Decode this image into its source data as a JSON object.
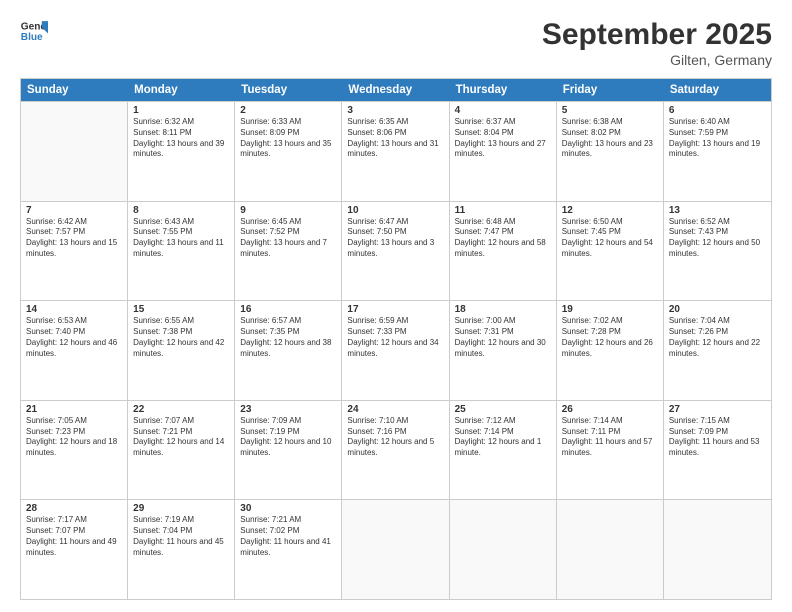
{
  "header": {
    "logo_line1": "General",
    "logo_line2": "Blue",
    "month": "September 2025",
    "location": "Gilten, Germany"
  },
  "days_of_week": [
    "Sunday",
    "Monday",
    "Tuesday",
    "Wednesday",
    "Thursday",
    "Friday",
    "Saturday"
  ],
  "weeks": [
    [
      {
        "day": "",
        "empty": true
      },
      {
        "day": "1",
        "sunrise": "6:32 AM",
        "sunset": "8:11 PM",
        "daylight": "13 hours and 39 minutes."
      },
      {
        "day": "2",
        "sunrise": "6:33 AM",
        "sunset": "8:09 PM",
        "daylight": "13 hours and 35 minutes."
      },
      {
        "day": "3",
        "sunrise": "6:35 AM",
        "sunset": "8:06 PM",
        "daylight": "13 hours and 31 minutes."
      },
      {
        "day": "4",
        "sunrise": "6:37 AM",
        "sunset": "8:04 PM",
        "daylight": "13 hours and 27 minutes."
      },
      {
        "day": "5",
        "sunrise": "6:38 AM",
        "sunset": "8:02 PM",
        "daylight": "13 hours and 23 minutes."
      },
      {
        "day": "6",
        "sunrise": "6:40 AM",
        "sunset": "7:59 PM",
        "daylight": "13 hours and 19 minutes."
      }
    ],
    [
      {
        "day": "7",
        "sunrise": "6:42 AM",
        "sunset": "7:57 PM",
        "daylight": "13 hours and 15 minutes."
      },
      {
        "day": "8",
        "sunrise": "6:43 AM",
        "sunset": "7:55 PM",
        "daylight": "13 hours and 11 minutes."
      },
      {
        "day": "9",
        "sunrise": "6:45 AM",
        "sunset": "7:52 PM",
        "daylight": "13 hours and 7 minutes."
      },
      {
        "day": "10",
        "sunrise": "6:47 AM",
        "sunset": "7:50 PM",
        "daylight": "13 hours and 3 minutes."
      },
      {
        "day": "11",
        "sunrise": "6:48 AM",
        "sunset": "7:47 PM",
        "daylight": "12 hours and 58 minutes."
      },
      {
        "day": "12",
        "sunrise": "6:50 AM",
        "sunset": "7:45 PM",
        "daylight": "12 hours and 54 minutes."
      },
      {
        "day": "13",
        "sunrise": "6:52 AM",
        "sunset": "7:43 PM",
        "daylight": "12 hours and 50 minutes."
      }
    ],
    [
      {
        "day": "14",
        "sunrise": "6:53 AM",
        "sunset": "7:40 PM",
        "daylight": "12 hours and 46 minutes."
      },
      {
        "day": "15",
        "sunrise": "6:55 AM",
        "sunset": "7:38 PM",
        "daylight": "12 hours and 42 minutes."
      },
      {
        "day": "16",
        "sunrise": "6:57 AM",
        "sunset": "7:35 PM",
        "daylight": "12 hours and 38 minutes."
      },
      {
        "day": "17",
        "sunrise": "6:59 AM",
        "sunset": "7:33 PM",
        "daylight": "12 hours and 34 minutes."
      },
      {
        "day": "18",
        "sunrise": "7:00 AM",
        "sunset": "7:31 PM",
        "daylight": "12 hours and 30 minutes."
      },
      {
        "day": "19",
        "sunrise": "7:02 AM",
        "sunset": "7:28 PM",
        "daylight": "12 hours and 26 minutes."
      },
      {
        "day": "20",
        "sunrise": "7:04 AM",
        "sunset": "7:26 PM",
        "daylight": "12 hours and 22 minutes."
      }
    ],
    [
      {
        "day": "21",
        "sunrise": "7:05 AM",
        "sunset": "7:23 PM",
        "daylight": "12 hours and 18 minutes."
      },
      {
        "day": "22",
        "sunrise": "7:07 AM",
        "sunset": "7:21 PM",
        "daylight": "12 hours and 14 minutes."
      },
      {
        "day": "23",
        "sunrise": "7:09 AM",
        "sunset": "7:19 PM",
        "daylight": "12 hours and 10 minutes."
      },
      {
        "day": "24",
        "sunrise": "7:10 AM",
        "sunset": "7:16 PM",
        "daylight": "12 hours and 5 minutes."
      },
      {
        "day": "25",
        "sunrise": "7:12 AM",
        "sunset": "7:14 PM",
        "daylight": "12 hours and 1 minute."
      },
      {
        "day": "26",
        "sunrise": "7:14 AM",
        "sunset": "7:11 PM",
        "daylight": "11 hours and 57 minutes."
      },
      {
        "day": "27",
        "sunrise": "7:15 AM",
        "sunset": "7:09 PM",
        "daylight": "11 hours and 53 minutes."
      }
    ],
    [
      {
        "day": "28",
        "sunrise": "7:17 AM",
        "sunset": "7:07 PM",
        "daylight": "11 hours and 49 minutes."
      },
      {
        "day": "29",
        "sunrise": "7:19 AM",
        "sunset": "7:04 PM",
        "daylight": "11 hours and 45 minutes."
      },
      {
        "day": "30",
        "sunrise": "7:21 AM",
        "sunset": "7:02 PM",
        "daylight": "11 hours and 41 minutes."
      },
      {
        "day": "",
        "empty": true
      },
      {
        "day": "",
        "empty": true
      },
      {
        "day": "",
        "empty": true
      },
      {
        "day": "",
        "empty": true
      }
    ]
  ]
}
